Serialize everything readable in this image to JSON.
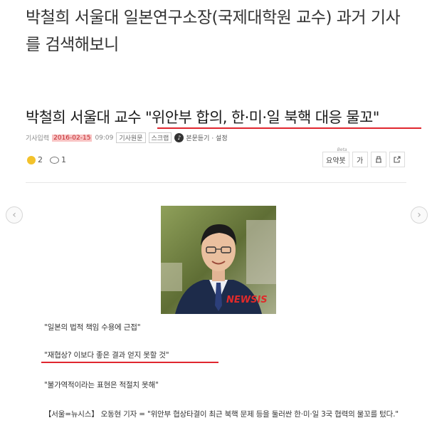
{
  "post": {
    "title": "박철희 서울대 일본연구소장(국제대학원 교수) 과거 기사를 검색해보니"
  },
  "article": {
    "title_prefix": "박철희 서울대 교수 ",
    "title_quote": "\"위안부 합의, 한·미·일 북핵 대응 물꼬\"",
    "meta": {
      "input_label": "기사입력",
      "date": "2016-02-15",
      "time": "09:09",
      "original_button": "기사원문",
      "scrap_button": "스크랩",
      "listen_label": "본문듣기 · 설정"
    },
    "reactions": {
      "smile_count": "2",
      "comment_count": "1"
    },
    "tools": {
      "summary_label": "요약봇",
      "summary_badge": "Beta",
      "font_label": "가"
    },
    "photo": {
      "watermark": "NEWSIS"
    },
    "quotes": [
      "\"일본의 법적 책임 수용에 근접\"",
      "\"재협상? 이보다 좋은 결과 얻지 못할 것\"",
      "\"불가역적이라는 표현은 적절치 못해\""
    ],
    "body": "【서울=뉴시스】 오동현 기자 = \"위안부 협상타결이 최근 북핵 문제 등을 둘러싼 한·미·일 3국 협력의 물꼬를 텄다.\""
  },
  "colors": {
    "highlight_red": "#e0262f",
    "date_bg": "#f9c4c4"
  }
}
